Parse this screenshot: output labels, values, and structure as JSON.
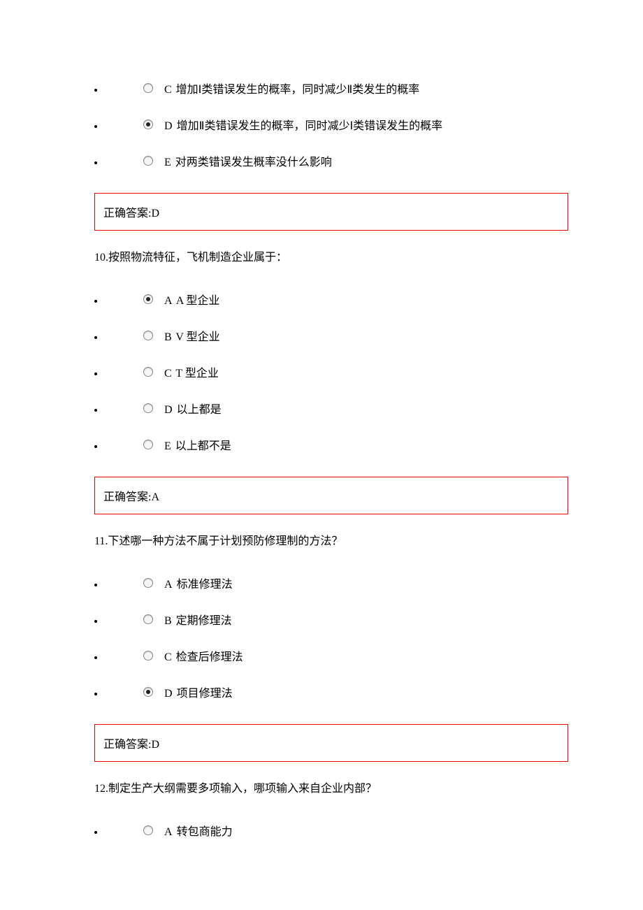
{
  "block1": {
    "options": [
      {
        "letter": "C",
        "text": "增加Ⅰ类错误发生的概率，同时减少Ⅱ类发生的概率",
        "selected": false
      },
      {
        "letter": "D",
        "text": "增加Ⅱ类错误发生的概率，同时减少Ⅰ类错误发生的概率",
        "selected": true
      },
      {
        "letter": "E",
        "text": "对两类错误发生概率没什么影响",
        "selected": false
      }
    ],
    "answer": "正确答案:D"
  },
  "q10": {
    "stem": "10.按照物流特征，飞机制造企业属于：",
    "options": [
      {
        "letter": "A",
        "text": "A 型企业",
        "selected": true
      },
      {
        "letter": "B",
        "text": "V 型企业",
        "selected": false
      },
      {
        "letter": "C",
        "text": "T 型企业",
        "selected": false
      },
      {
        "letter": "D",
        "text": "以上都是",
        "selected": false
      },
      {
        "letter": "E",
        "text": "以上都不是",
        "selected": false
      }
    ],
    "answer": "正确答案:A"
  },
  "q11": {
    "stem": "11.下述哪一种方法不属于计划预防修理制的方法？",
    "options": [
      {
        "letter": "A",
        "text": "标准修理法",
        "selected": false
      },
      {
        "letter": "B",
        "text": "定期修理法",
        "selected": false
      },
      {
        "letter": "C",
        "text": "检查后修理法",
        "selected": false
      },
      {
        "letter": "D",
        "text": "项目修理法",
        "selected": true
      }
    ],
    "answer": "正确答案:D"
  },
  "q12": {
    "stem": "12.制定生产大纲需要多项输入，哪项输入来自企业内部？",
    "options": [
      {
        "letter": "A",
        "text": "转包商能力",
        "selected": false
      }
    ]
  }
}
